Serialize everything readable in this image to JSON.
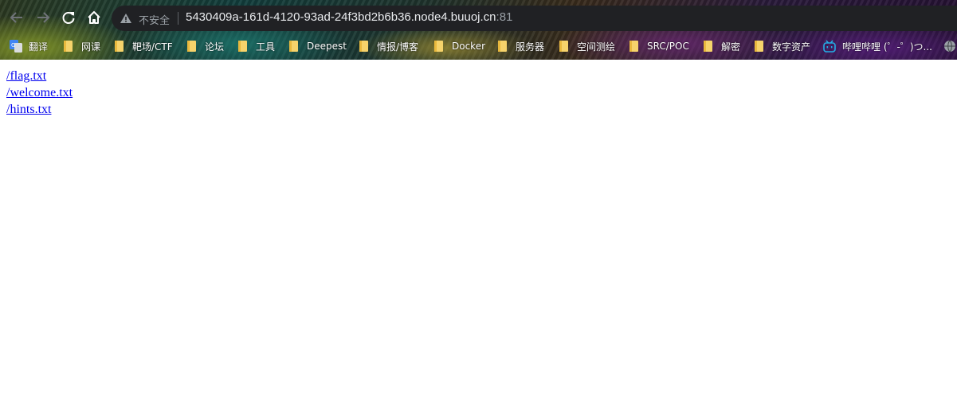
{
  "address_bar": {
    "security_label": "不安全",
    "url_host": "5430409a-161d-4120-93ad-24f3bd2b6b36.node4.buuoj.cn",
    "url_port": ":81"
  },
  "bookmarks": [
    {
      "label": "翻译",
      "icon": "google-translate-icon"
    },
    {
      "label": "网课",
      "icon": "folder-icon"
    },
    {
      "label": "靶场/CTF",
      "icon": "folder-icon"
    },
    {
      "label": "论坛",
      "icon": "folder-icon"
    },
    {
      "label": "工具",
      "icon": "folder-icon"
    },
    {
      "label": "Deepest",
      "icon": "folder-icon"
    },
    {
      "label": "情报/博客",
      "icon": "folder-icon"
    },
    {
      "label": "Docker",
      "icon": "folder-icon"
    },
    {
      "label": "服务器",
      "icon": "folder-icon"
    },
    {
      "label": "空间测绘",
      "icon": "folder-icon"
    },
    {
      "label": "SRC/POC",
      "icon": "folder-icon"
    },
    {
      "label": "解密",
      "icon": "folder-icon"
    },
    {
      "label": "数字资产",
      "icon": "folder-icon"
    },
    {
      "label": "哔哩哔哩 (゜-゜)つ...",
      "icon": "bilibili-icon"
    }
  ],
  "page": {
    "links": [
      "/flag.txt",
      "/welcome.txt",
      "/hints.txt"
    ]
  },
  "colors": {
    "link": "#0000ee",
    "omnibox_bg": "#202124",
    "folder": "#f6d36b"
  }
}
